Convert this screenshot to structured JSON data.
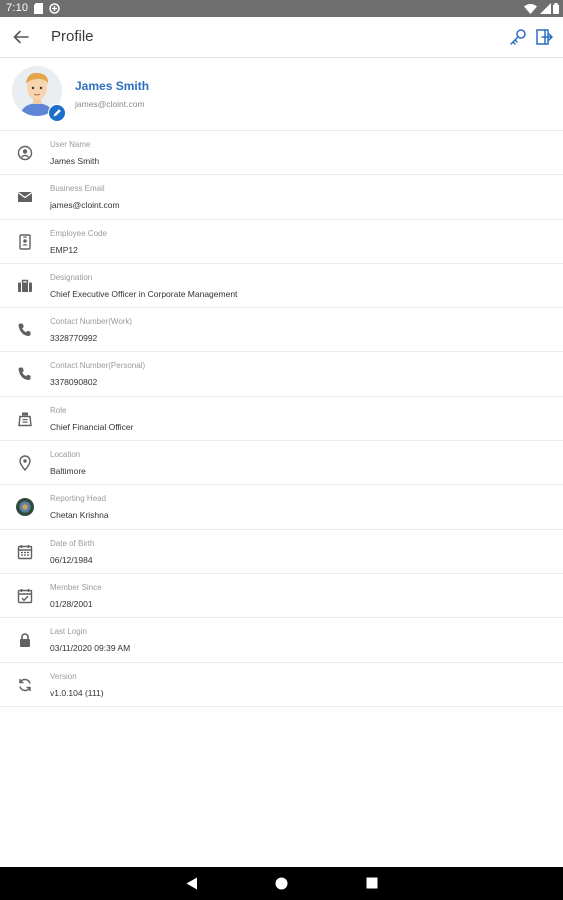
{
  "status_bar": {
    "time": "7:10"
  },
  "app_bar": {
    "title": "Profile"
  },
  "profile": {
    "name": "James Smith",
    "email": "james@cloint.com"
  },
  "fields": [
    {
      "icon": "user-circle-icon",
      "label": "User Name",
      "value": "James Smith"
    },
    {
      "icon": "mail-icon",
      "label": "Business Email",
      "value": "james@cloint.com"
    },
    {
      "icon": "id-badge-icon",
      "label": "Employee Code",
      "value": "EMP12"
    },
    {
      "icon": "briefcase-icon",
      "label": "Designation",
      "value": "Chief Executive Officer in Corporate Management"
    },
    {
      "icon": "phone-icon",
      "label": "Contact Number(Work)",
      "value": "3328770992"
    },
    {
      "icon": "phone-icon",
      "label": "Contact Number(Personal)",
      "value": "3378090802"
    },
    {
      "icon": "role-icon",
      "label": "Role",
      "value": "Chief Financial Officer"
    },
    {
      "icon": "location-pin-icon",
      "label": "Location",
      "value": "Baltimore"
    },
    {
      "icon": "reporting-head-avatar",
      "label": "Reporting Head",
      "value": "Chetan Krishna"
    },
    {
      "icon": "calendar-icon",
      "label": "Date of Birth",
      "value": "06/12/1984"
    },
    {
      "icon": "calendar-check-icon",
      "label": "Member Since",
      "value": "01/28/2001"
    },
    {
      "icon": "lock-icon",
      "label": "Last Login",
      "value": "03/11/2020 09:39 AM"
    },
    {
      "icon": "sync-icon",
      "label": "Version",
      "value": "v1.0.104 (111)"
    }
  ],
  "colors": {
    "accent": "#2c6fbf",
    "status_bar": "#6e6e6e",
    "icon_gray": "#616161"
  }
}
